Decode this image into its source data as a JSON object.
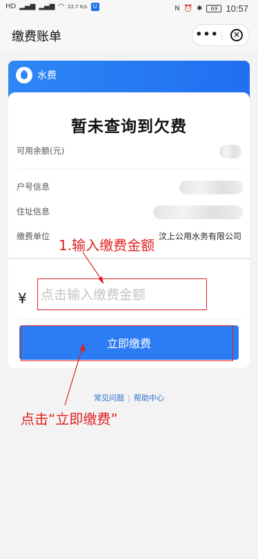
{
  "status_bar": {
    "net_speed": "22.7\nK/s",
    "battery": "69",
    "time": "10:57"
  },
  "header": {
    "title": "缴费账单",
    "more_glyph": "•••",
    "close_glyph": "×"
  },
  "banner": {
    "label": "水费",
    "icon": "water-drop-icon",
    "color": "#2f86f5"
  },
  "bill": {
    "headline": "暂未查询到欠费",
    "rows": [
      {
        "label": "可用余额(元)"
      },
      {
        "label": "户号信息"
      },
      {
        "label": "住址信息"
      },
      {
        "label": "缴费单位",
        "value": "汶上公用水务有限公司"
      }
    ]
  },
  "payment": {
    "currency": "¥",
    "amount_value": "",
    "amount_placeholder": "点击输入缴费金额",
    "pay_button_label": "立即缴费",
    "button_color": "#2b7cf3"
  },
  "footer": {
    "faq_label": "常见问题",
    "separator": "|",
    "help_label": "帮助中心"
  },
  "annotations": {
    "step1_text": "1.输入缴费金额",
    "step2_text": "点击“立即缴费”",
    "color": "#e02020"
  }
}
